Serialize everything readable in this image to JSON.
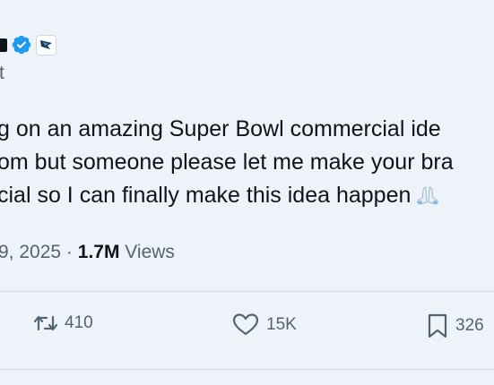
{
  "tweet": {
    "handle_fragment": "t",
    "lines": [
      "g on an amazing Super Bowl commercial ide",
      "om but someone please let me make your bra",
      "cial so I can finally make this idea happen"
    ],
    "emoji": "folded-hands",
    "date_fragment": "9, 2025",
    "separator": "·",
    "views_count": "1.7M",
    "views_label": "Views"
  },
  "actions": {
    "retweets": "410",
    "likes": "15K",
    "bookmarks": "326"
  },
  "colors": {
    "background": "#eef3f9",
    "text": "#0f1419",
    "secondary_text": "#536471",
    "verified_blue": "#1d9bf0"
  }
}
